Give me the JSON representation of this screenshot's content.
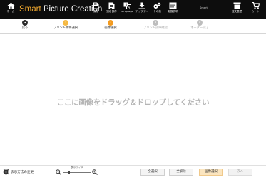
{
  "header": {
    "home_label": "ホーム",
    "app_title_part1": "Smart",
    "app_title_part2": " Picture Creation",
    "save_label": "保存",
    "save_as_label": "別名保存",
    "language_label": "Language",
    "app_update_label": "アップデ...",
    "other_label": "その他",
    "manual_label": "取扱説明",
    "smart_label": "Smart",
    "cart_history_label": "注文履歴",
    "cart_label": "カート"
  },
  "stepper": {
    "back_label": "戻る",
    "steps": [
      {
        "num": "1",
        "label": "プリント条件選択"
      },
      {
        "num": "2",
        "label": "画像選択"
      },
      {
        "num": "3",
        "label": "プリント詳細確認"
      },
      {
        "num": "4",
        "label": "オーダー完了"
      }
    ]
  },
  "drop_zone": {
    "text": "ここに画像をドラッグ＆ドロップしてください"
  },
  "footer": {
    "view_settings_label": "表示方法の変更",
    "zoom_label": "表示サイズ",
    "zoom_level": 0.2,
    "deselect_all_label": "全選択",
    "select_all_label": "全解除",
    "image_select_label": "画像選択",
    "next_label": "次へ"
  },
  "colors": {
    "header_bg": "#0d0d0d",
    "accent": "#f2a92f",
    "step_done": "#f5b942",
    "step_current": "#f29a1f",
    "step_inactive": "#bdbdbd",
    "primary_button_bg": "#fbe5bf"
  }
}
